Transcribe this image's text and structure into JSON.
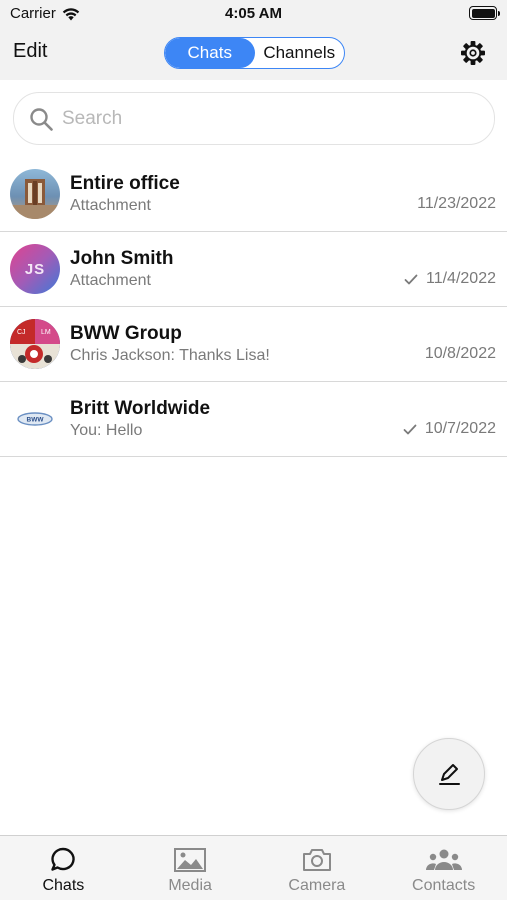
{
  "status": {
    "carrier": "Carrier",
    "time": "4:05 AM"
  },
  "nav": {
    "edit": "Edit",
    "segments": [
      "Chats",
      "Channels"
    ],
    "active_segment": "Chats"
  },
  "search": {
    "placeholder": "Search",
    "value": ""
  },
  "chats": [
    {
      "name": "Entire office",
      "preview": "Attachment",
      "date": "11/23/2022",
      "read_check": false,
      "avatar": "group-photo"
    },
    {
      "name": "John Smith",
      "preview": "Attachment",
      "date": "11/4/2022",
      "read_check": true,
      "avatar_initials": "JS"
    },
    {
      "name": "BWW Group",
      "preview": "Chris Jackson: Thanks Lisa!",
      "date": "10/8/2022",
      "read_check": false,
      "avatar_initials": [
        "CJ",
        "LM"
      ]
    },
    {
      "name": "Britt Worldwide",
      "preview": "You: Hello",
      "date": "10/7/2022",
      "read_check": true,
      "avatar_text": "BWW"
    }
  ],
  "tabs": [
    {
      "label": "Chats",
      "icon": "chat-bubble-icon",
      "active": true
    },
    {
      "label": "Media",
      "icon": "image-icon",
      "active": false
    },
    {
      "label": "Camera",
      "icon": "camera-icon",
      "active": false
    },
    {
      "label": "Contacts",
      "icon": "people-icon",
      "active": false
    }
  ],
  "colors": {
    "accent": "#3d86f5",
    "tabbar": "#f5f5f5",
    "muted_text": "#7a7a7a"
  }
}
